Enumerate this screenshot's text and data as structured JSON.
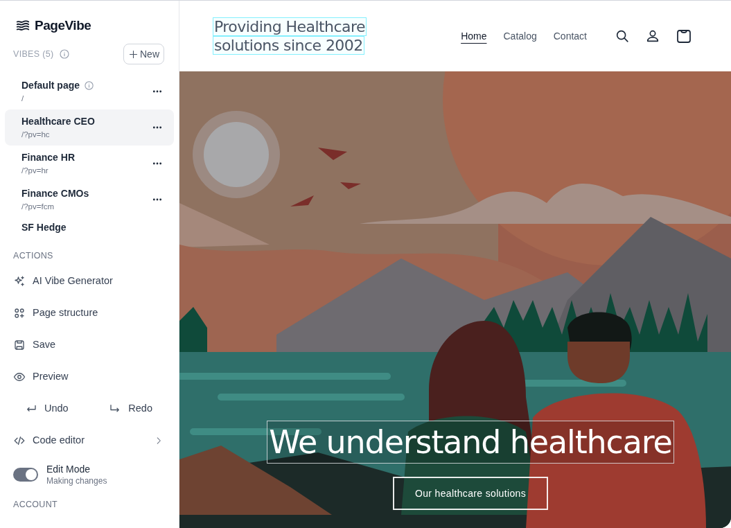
{
  "logo": {
    "text": "PageVibe"
  },
  "vibes": {
    "heading": "VIBES (5)",
    "new_button": "New",
    "items": [
      {
        "name": "Default page",
        "path": "/",
        "info": true,
        "selected": false
      },
      {
        "name": "Healthcare CEO",
        "path": "/?pv=hc",
        "selected": true
      },
      {
        "name": "Finance HR",
        "path": "/?pv=hr",
        "selected": false
      },
      {
        "name": "Finance CMOs",
        "path": "/?pv=fcm",
        "selected": false
      },
      {
        "name": "SF Hedge",
        "selected": false
      }
    ]
  },
  "actions": {
    "heading": "ACTIONS",
    "items": [
      {
        "kind": "link",
        "label": "AI Vibe Generator"
      },
      {
        "kind": "link",
        "label": "Page structure"
      },
      {
        "kind": "link",
        "label": "Save"
      },
      {
        "kind": "link",
        "label": "Preview"
      },
      {
        "kind": "pair",
        "labels": [
          "Undo",
          "Redo"
        ]
      },
      {
        "kind": "submenu",
        "label": "Code editor"
      },
      {
        "kind": "toggle",
        "label": "Edit Mode",
        "sublabel": "Making changes",
        "on": true
      }
    ]
  },
  "account": {
    "heading": "ACCOUNT"
  },
  "site": {
    "brand_lines": [
      "Providing Healthcare",
      "solutions since 2002"
    ],
    "nav": [
      {
        "label": "Home",
        "selected": true
      },
      {
        "label": "Catalog",
        "selected": false
      },
      {
        "label": "Contact",
        "selected": false
      }
    ],
    "hero": {
      "heading": "We understand healthcare",
      "button": "Our healthcare solutions"
    }
  }
}
